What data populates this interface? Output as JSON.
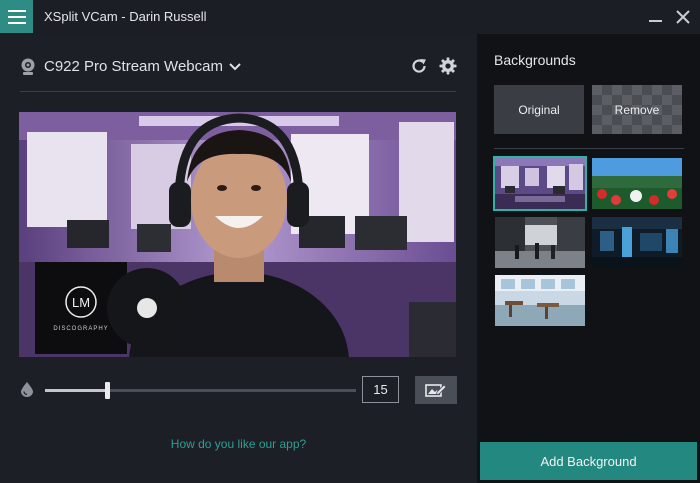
{
  "window": {
    "title": "XSplit VCam - Darin Russell",
    "menu_icon": "hamburger-icon",
    "accent_color": "#2e8c84"
  },
  "camera": {
    "selected": "C922 Pro Stream Webcam",
    "icon": "webcam-icon"
  },
  "preview": {
    "logo_text": "LM",
    "logo_subtitle": "DISCOGRAPHY"
  },
  "blur": {
    "value": "15",
    "slider_fraction": 0.2
  },
  "feedback_link": "How do you like our app?",
  "backgrounds": {
    "title": "Backgrounds",
    "original_label": "Original",
    "remove_label": "Remove",
    "thumbnails": [
      {
        "name": "studio",
        "selected": true
      },
      {
        "name": "tulips"
      },
      {
        "name": "street"
      },
      {
        "name": "office-blue"
      },
      {
        "name": "cafe"
      }
    ],
    "add_button": "Add Background"
  },
  "colors": {
    "link": "#2d9e96",
    "selected_outline": "#2db3a7",
    "add_button": "#23887f"
  }
}
